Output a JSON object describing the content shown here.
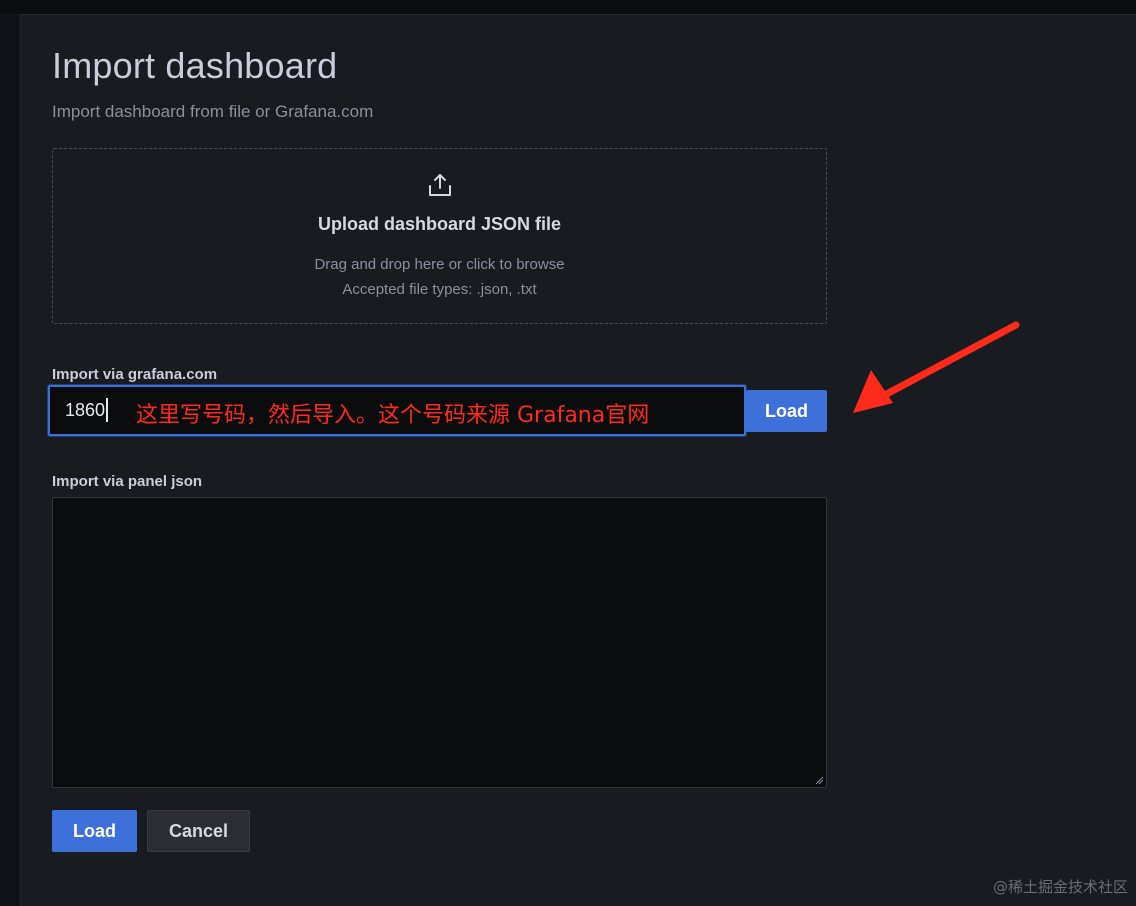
{
  "header": {
    "title": "Import dashboard",
    "subtitle": "Import dashboard from file or Grafana.com"
  },
  "upload": {
    "icon": "upload-icon",
    "title": "Upload dashboard JSON file",
    "description": "Drag and drop here or click to browse",
    "accepted_types": "Accepted file types: .json, .txt"
  },
  "grafana_com": {
    "label": "Import via grafana.com",
    "value": "1860",
    "load_label": "Load"
  },
  "annotation": {
    "text": "这里写号码，然后导入。这个号码来源 Grafana官网",
    "color": "#ff2a1a"
  },
  "panel_json": {
    "label": "Import via panel json",
    "value": ""
  },
  "footer": {
    "load_label": "Load",
    "cancel_label": "Cancel"
  },
  "watermark": "@稀土掘金技术社区",
  "colors": {
    "background": "#111217",
    "panel": "#181b1f",
    "primary": "#3d71d9",
    "input_bg": "#0b0c0e"
  }
}
